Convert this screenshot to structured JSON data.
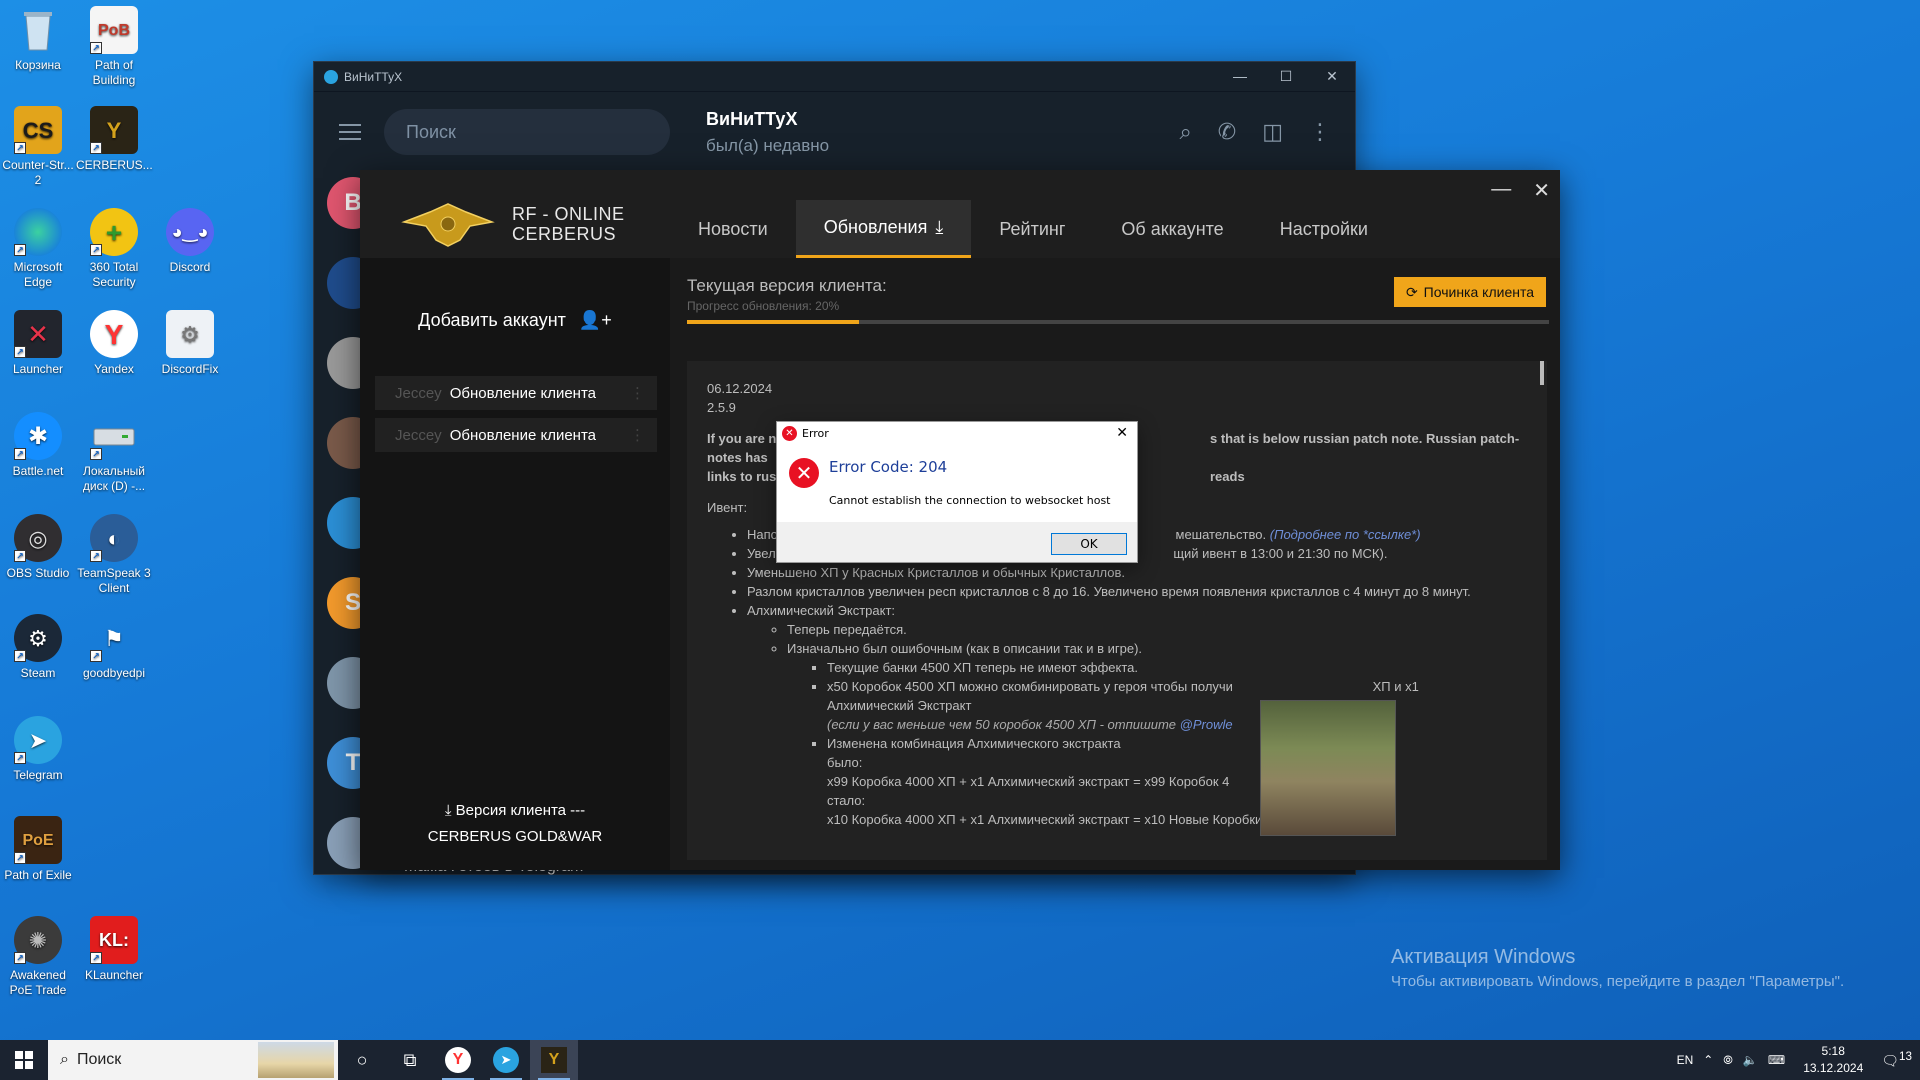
{
  "desktop": {
    "icons": [
      {
        "label": "Корзина",
        "icon": "recycle-bin-icon"
      },
      {
        "label": "Path of Building",
        "icon": "path-of-building-icon"
      },
      {
        "label": "Counter-Str... 2",
        "icon": "counter-strike-icon"
      },
      {
        "label": "CERBERUS...",
        "icon": "cerberus-icon"
      },
      {
        "label": "Microsoft Edge",
        "icon": "edge-icon"
      },
      {
        "label": "360 Total Security",
        "icon": "360-security-icon"
      },
      {
        "label": "Discord",
        "icon": "discord-icon"
      },
      {
        "label": "Launcher",
        "icon": "launcher-icon"
      },
      {
        "label": "Yandex",
        "icon": "yandex-icon"
      },
      {
        "label": "DiscordFix",
        "icon": "discordfix-icon"
      },
      {
        "label": "Battle.net",
        "icon": "battlenet-icon"
      },
      {
        "label": "Локальный диск (D) -...",
        "icon": "drive-icon"
      },
      {
        "label": "OBS Studio",
        "icon": "obs-icon"
      },
      {
        "label": "TeamSpeak 3 Client",
        "icon": "teamspeak-icon"
      },
      {
        "label": "Steam",
        "icon": "steam-icon"
      },
      {
        "label": "goodbyedpi",
        "icon": "goodbyedpi-icon"
      },
      {
        "label": "Telegram",
        "icon": "telegram-icon"
      },
      {
        "label": "Path of Exile",
        "icon": "poe-icon"
      },
      {
        "label": "Awakened PoE Trade",
        "icon": "awakened-poe-icon"
      },
      {
        "label": "KLauncher",
        "icon": "klauncher-icon"
      }
    ]
  },
  "telegram": {
    "window_title": "ВиНиТТуХ",
    "search_placeholder": "Поиск",
    "chat_name": "ВиНиТТуХ",
    "chat_status": "был(а) недавно",
    "avatars": [
      {
        "letter": "В",
        "color": "#e0566f"
      },
      {
        "letter": "",
        "color": "#1f4c8c"
      },
      {
        "letter": "",
        "color": "#9a9a9a"
      },
      {
        "letter": "",
        "color": "#7a5a4a"
      },
      {
        "letter": "",
        "color": "#2b8fd6"
      },
      {
        "letter": "S",
        "color": "#f39a2c"
      },
      {
        "letter": "",
        "color": "#7f96aa"
      },
      {
        "letter": "T",
        "color": "#3e8fd8"
      },
      {
        "letter": "",
        "color": "#8aa0b8"
      }
    ],
    "bottom_chat": "Мама Гетеев в Telegram"
  },
  "launcher": {
    "logo_line1": "RF - ONLINE",
    "logo_line2": "CERBERUS",
    "tabs": [
      "Новости",
      "Обновления",
      "Рейтинг",
      "Об аккаунте",
      "Настройки"
    ],
    "active_tab": 1,
    "add_account": "Добавить аккаунт",
    "accounts": [
      {
        "nick": "Jeccey",
        "status": "Обновление клиента"
      },
      {
        "nick": "Jeccey",
        "status": "Обновление клиента"
      }
    ],
    "version_label": "Версия клиента ---",
    "version_name": "CERBERUS GOLD&WAR",
    "current_version_label": "Текущая версия клиента:",
    "progress_label": "Прогресс обновления: 20%",
    "progress_value": 0.2,
    "repair_button": "Починка клиента",
    "accent_color": "#f0a51a",
    "news": {
      "date": "06.12.2024",
      "version": "2.5.9",
      "intro": "If you are n",
      "intro_tail": "s that is below russian patch note. Russian patch-notes has",
      "intro2": "links to rus",
      "intro2_tail": "reads",
      "event_label": "Ивент:",
      "item1": "Напо",
      "item1_tail": "мешательство.",
      "item1_link": "(Подробнее по *ссылке*)",
      "item2": "Увел",
      "item2_tail": "щий ивент в 13:00 и 21:30 по МСК).",
      "item3": "Уменьшено ХП у Красных Кристаллов и обычных Кристаллов.",
      "item4": "Разлом кристаллов увеличен респ кристаллов с 8 до 16. Увеличено время появления кристаллов с 4 минут до 8 минут.",
      "item5": "Алхимический Экстракт:",
      "sub1": "Теперь передаётся.",
      "sub2": "Изначально был ошибочным (как в описании так и в игре).",
      "subsub1": "Текущие банки 4500 ХП теперь не имеют эффекта.",
      "subsub2": "x50 Коробок 4500 ХП можно скомбинировать у героя чтобы получи",
      "subsub2_tail": "ХП и x1",
      "subsub2_line2": "Алхимический Экстракт",
      "subsub2_note": "(если у вас меньше чем 50 коробок 4500 ХП - отпишите",
      "subsub2_link": "@Prowle",
      "subsub3": "Изменена комбинация Алхимического экстракта",
      "was_label": "было:",
      "was_line": "x99 Коробка 4000 ХП + x1 Алхимический экстракт = x99 Коробок 4",
      "now_label": "стало:",
      "now_line": "x10 Коробка 4000 ХП + x1 Алхимический экстракт = x10 Новые Коробки 4500 ХП"
    }
  },
  "error_dialog": {
    "title": "Error",
    "code": "Error Code: 204",
    "message": "Cannot establish the connection to websocket host",
    "ok": "OK"
  },
  "watermark": {
    "line1": "Активация Windows",
    "line2": "Чтобы активировать Windows, перейдите в раздел \"Параметры\"."
  },
  "taskbar": {
    "search_placeholder": "Поиск",
    "lang": "EN",
    "time": "5:18",
    "date": "13.12.2024",
    "notifications": "13"
  }
}
